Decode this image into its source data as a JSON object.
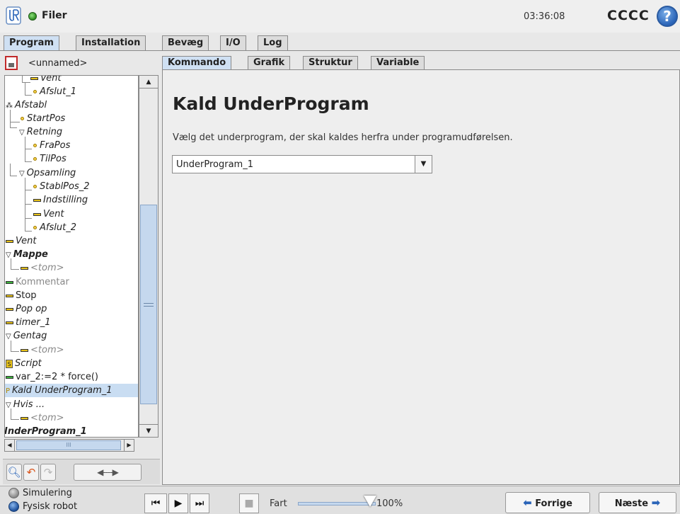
{
  "titlebar": {
    "app_title": "Filer",
    "clock": "03:36:08",
    "robot_name": "CCCC",
    "help_glyph": "?"
  },
  "main_tabs": [
    {
      "label": "Program",
      "active": true
    },
    {
      "label": "Installation",
      "active": false
    },
    {
      "label": "Bevæg",
      "active": false
    },
    {
      "label": "I/O",
      "active": false
    },
    {
      "label": "Log",
      "active": false
    }
  ],
  "left_panel": {
    "file_name": "<unnamed>",
    "tree": [
      {
        "label": "Vent",
        "icon": "bar"
      },
      {
        "label": "Afslut_1",
        "icon": "waypoint"
      },
      {
        "label": "Afstabl",
        "icon": "pallet"
      },
      {
        "label": "StartPos",
        "icon": "waypoint"
      },
      {
        "label": "Retning",
        "icon": "triangle"
      },
      {
        "label": "FraPos",
        "icon": "waypoint"
      },
      {
        "label": "TilPos",
        "icon": "waypoint"
      },
      {
        "label": "Opsamling",
        "icon": "triangle"
      },
      {
        "label": "StablPos_2",
        "icon": "waypoint"
      },
      {
        "label": "Indstilling",
        "icon": "bar"
      },
      {
        "label": "Vent",
        "icon": "bar"
      },
      {
        "label": "Afslut_2",
        "icon": "waypoint"
      },
      {
        "label": "Vent",
        "icon": "bar"
      },
      {
        "label": "Mappe",
        "icon": "triangle"
      },
      {
        "label": "<tom>",
        "icon": "bar"
      },
      {
        "label": "Kommentar",
        "icon": "bar-green"
      },
      {
        "label": "Stop",
        "icon": "bar"
      },
      {
        "label": "Pop op",
        "icon": "bar"
      },
      {
        "label": "timer_1",
        "icon": "bar"
      },
      {
        "label": "Gentag",
        "icon": "triangle"
      },
      {
        "label": "<tom>",
        "icon": "bar"
      },
      {
        "label": "Script",
        "icon": "script"
      },
      {
        "label": "var_2:=2 * force()",
        "icon": "bar-green"
      },
      {
        "label": "Kald UnderProgram_1",
        "icon": "subprogram",
        "selected": true
      },
      {
        "label": "Hvis ...",
        "icon": "triangle"
      },
      {
        "label": "<tom>",
        "icon": "bar"
      },
      {
        "label": "InderProgram_1",
        "icon": "none"
      }
    ],
    "hscroll_grip": "III",
    "move_arrows": "◀----▶"
  },
  "content_tabs": [
    {
      "label": "Kommando",
      "active": true
    },
    {
      "label": "Grafik",
      "active": false
    },
    {
      "label": "Struktur",
      "active": false
    },
    {
      "label": "Variable",
      "active": false
    }
  ],
  "content": {
    "title": "Kald UnderProgram",
    "description": "Vælg det underprogram, der skal kaldes herfra under programudførelsen.",
    "subprogram_value": "UnderProgram_1"
  },
  "bottom": {
    "mode_sim": "Simulering",
    "mode_real": "Fysisk robot",
    "speed_label": "Fart",
    "speed_value": "100%",
    "speed_fraction": 1.0,
    "prev_label": "Forrige",
    "next_label": "Næste"
  },
  "colors": {
    "accent_blue": "#2a64b8",
    "selected_tab": "#cfe0f3",
    "tree_selected": "#c9ddf2"
  }
}
